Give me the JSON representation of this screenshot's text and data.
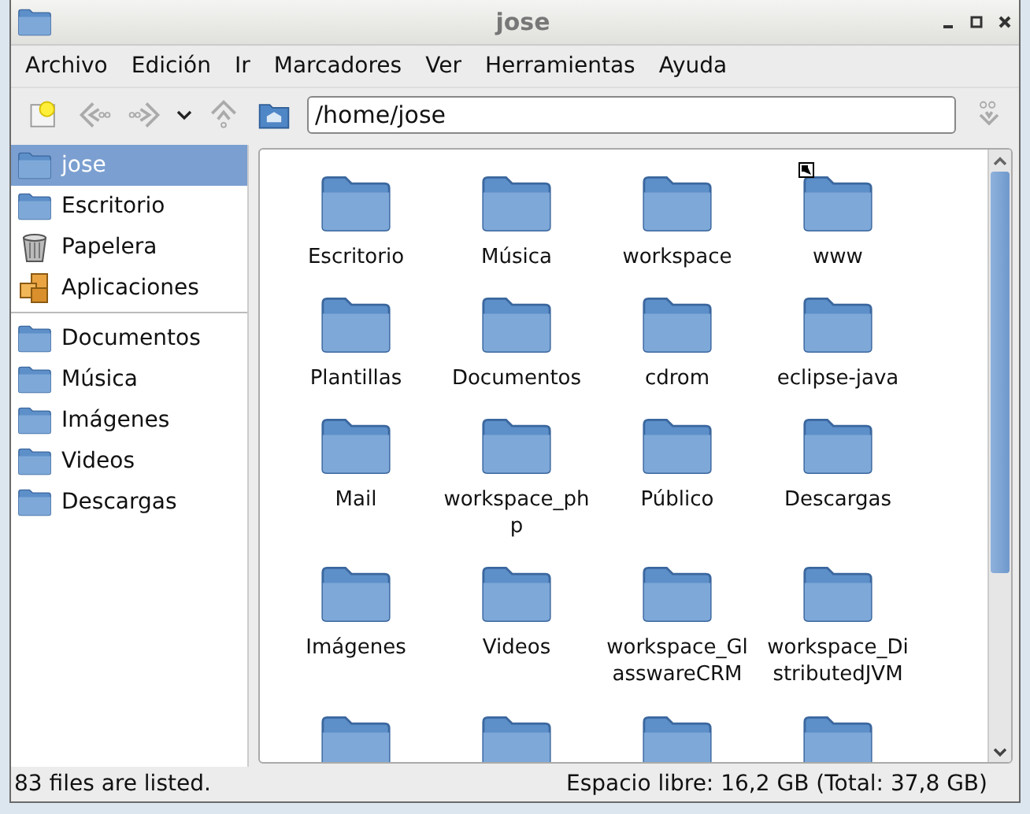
{
  "window": {
    "title": "jose"
  },
  "menu": [
    "Archivo",
    "Edición",
    "Ir",
    "Marcadores",
    "Ver",
    "Herramientas",
    "Ayuda"
  ],
  "location": {
    "value": "/home/jose"
  },
  "sidebar": {
    "places": [
      {
        "name": "jose",
        "kind": "folder",
        "selected": true
      },
      {
        "name": "Escritorio",
        "kind": "folder",
        "selected": false
      },
      {
        "name": "Papelera",
        "kind": "trash",
        "selected": false
      },
      {
        "name": "Aplicaciones",
        "kind": "apps",
        "selected": false
      }
    ],
    "bookmarks": [
      {
        "name": "Documentos",
        "kind": "folder",
        "selected": false
      },
      {
        "name": "Música",
        "kind": "folder",
        "selected": false
      },
      {
        "name": "Imágenes",
        "kind": "folder",
        "selected": false
      },
      {
        "name": "Videos",
        "kind": "folder",
        "selected": false
      },
      {
        "name": "Descargas",
        "kind": "folder",
        "selected": false
      }
    ]
  },
  "files": [
    {
      "name": "Escritorio",
      "link": false
    },
    {
      "name": "Música",
      "link": false
    },
    {
      "name": "workspace",
      "link": false
    },
    {
      "name": "www",
      "link": true
    },
    {
      "name": "Plantillas",
      "link": false
    },
    {
      "name": "Documentos",
      "link": false
    },
    {
      "name": "cdrom",
      "link": false
    },
    {
      "name": "eclipse-java",
      "link": false
    },
    {
      "name": "Mail",
      "link": false
    },
    {
      "name": "workspace_php",
      "link": false
    },
    {
      "name": "Público",
      "link": false
    },
    {
      "name": "Descargas",
      "link": false
    },
    {
      "name": "Imágenes",
      "link": false
    },
    {
      "name": "Videos",
      "link": false
    },
    {
      "name": "workspace_GlasswareCRM",
      "link": false
    },
    {
      "name": "workspace_DistributedJVM",
      "link": false
    },
    {
      "link": false
    },
    {
      "link": false
    },
    {
      "link": false
    },
    {
      "link": false
    }
  ],
  "status_bar": {
    "left": "83 files are listed.",
    "right": "Espacio libre: 16,2 GB (Total: 37,8 GB)"
  }
}
